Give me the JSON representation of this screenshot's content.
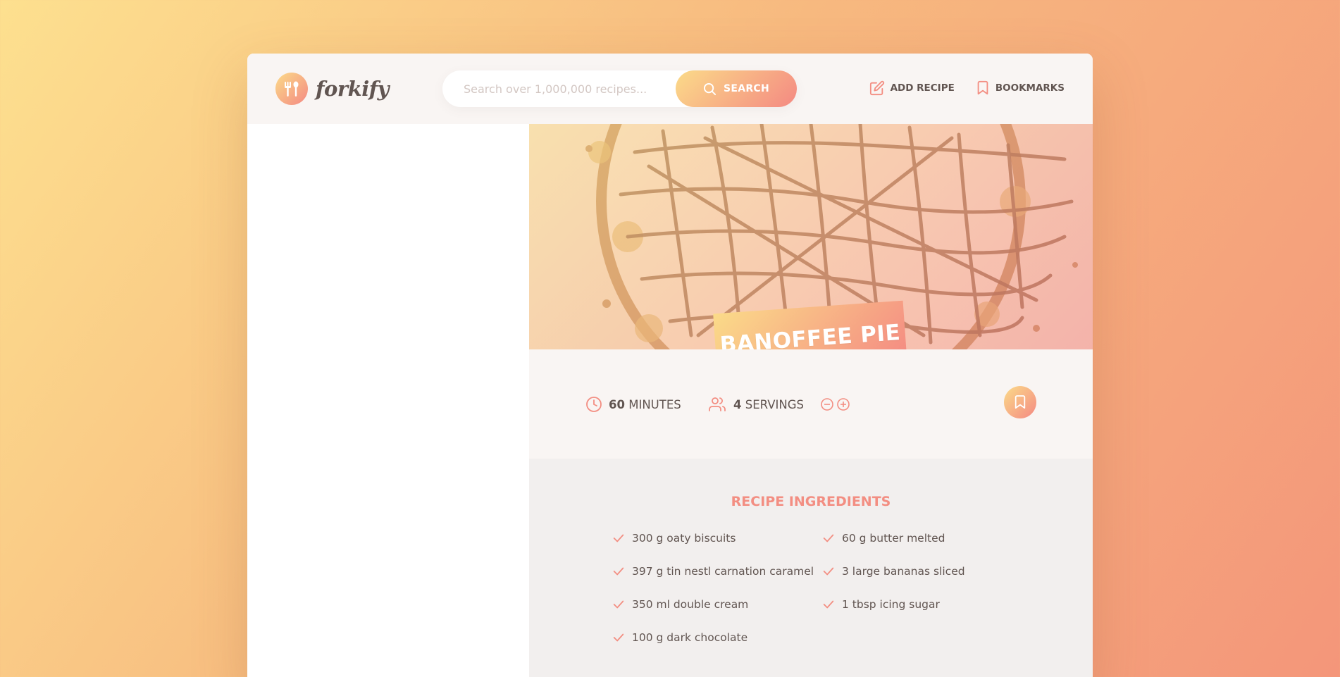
{
  "app": {
    "name": "forkify"
  },
  "search": {
    "placeholder": "Search over 1,000,000 recipes...",
    "button_label": "SEARCH"
  },
  "nav": {
    "add_recipe": "ADD RECIPE",
    "bookmarks": "BOOKMARKS"
  },
  "recipe": {
    "title": "BANOFFEE PIE",
    "cooking_time": "60",
    "cooking_time_unit": "MINUTES",
    "servings": "4",
    "servings_unit": "SERVINGS"
  },
  "ingredients": {
    "heading": "RECIPE INGREDIENTS",
    "items": [
      "300 g oaty biscuits",
      "60 g butter melted",
      "397 g tin nestl carnation caramel",
      "3 large bananas sliced",
      "350 ml double cream",
      "1 tbsp icing sugar",
      "100 g dark chocolate"
    ]
  },
  "colors": {
    "accent_from": "#fbdb89",
    "accent_to": "#f48982",
    "text": "#615551"
  },
  "icons": [
    "fork-spoon-icon",
    "search-icon",
    "edit-icon",
    "bookmark-icon",
    "clock-icon",
    "users-icon",
    "minus-circle-icon",
    "plus-circle-icon",
    "check-icon"
  ]
}
